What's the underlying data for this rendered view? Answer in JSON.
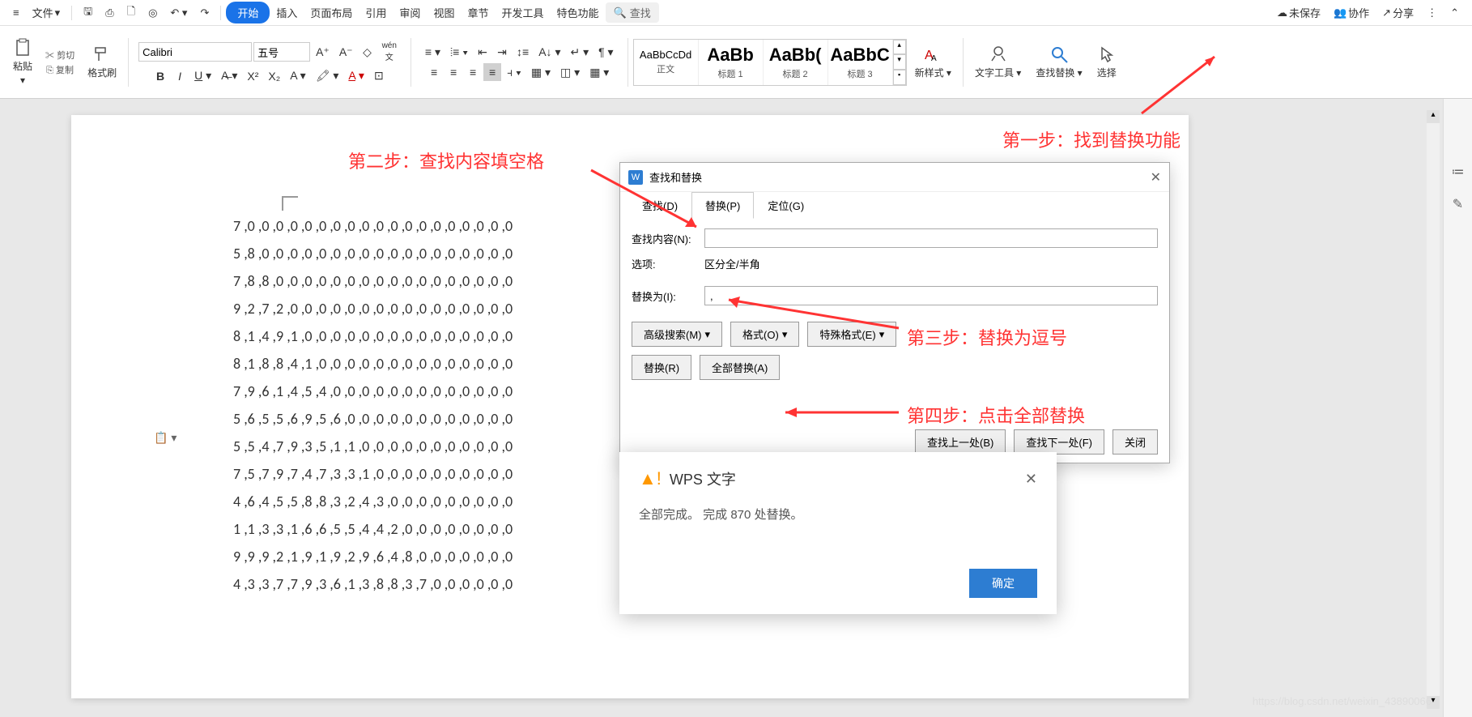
{
  "menubar": {
    "file": "文件",
    "tabs": [
      "开始",
      "插入",
      "页面布局",
      "引用",
      "审阅",
      "视图",
      "章节",
      "开发工具",
      "特色功能"
    ],
    "search": "查找",
    "unsaved": "未保存",
    "collab": "协作",
    "share": "分享"
  },
  "ribbon": {
    "paste": "粘贴",
    "cut": "剪切",
    "copy": "复制",
    "format_painter": "格式刷",
    "font_name": "Calibri",
    "font_size": "五号",
    "styles": [
      {
        "preview": "AaBbCcDd",
        "name": "正文",
        "big": false
      },
      {
        "preview": "AaBb",
        "name": "标题 1",
        "big": true
      },
      {
        "preview": "AaBb(",
        "name": "标题 2",
        "big": true
      },
      {
        "preview": "AaBbC",
        "name": "标题 3",
        "big": true
      }
    ],
    "new_style": "新样式",
    "text_tools": "文字工具",
    "find_replace": "查找替换",
    "select": "选择"
  },
  "annotations": {
    "step1": "第一步：找到替换功能",
    "step2": "第二步：查找内容填空格",
    "step3": "第三步：替换为逗号",
    "step4": "第四步：点击全部替换"
  },
  "doc_lines": [
    "7 ,0 ,0 ,0 ,0 ,0 ,0 ,0 ,0 ,0 ,0 ,0 ,0 ,0 ,0 ,0 ,0 ,0 ,0 ,0",
    "5 ,8 ,0 ,0 ,0 ,0 ,0 ,0 ,0 ,0 ,0 ,0 ,0 ,0 ,0 ,0 ,0 ,0 ,0 ,0",
    "7 ,8 ,8 ,0 ,0 ,0 ,0 ,0 ,0 ,0 ,0 ,0 ,0 ,0 ,0 ,0 ,0 ,0 ,0 ,0",
    "9 ,2 ,7 ,2 ,0 ,0 ,0 ,0 ,0 ,0 ,0 ,0 ,0 ,0 ,0 ,0 ,0 ,0 ,0 ,0",
    "8 ,1 ,4 ,9 ,1 ,0 ,0 ,0 ,0 ,0 ,0 ,0 ,0 ,0 ,0 ,0 ,0 ,0 ,0 ,0",
    "8 ,1 ,8 ,8 ,4 ,1 ,0 ,0 ,0 ,0 ,0 ,0 ,0 ,0 ,0 ,0 ,0 ,0 ,0 ,0",
    "7 ,9 ,6 ,1 ,4 ,5 ,4 ,0 ,0 ,0 ,0 ,0 ,0 ,0 ,0 ,0 ,0 ,0 ,0 ,0",
    "5 ,6 ,5 ,5 ,6 ,9 ,5 ,6 ,0 ,0 ,0 ,0 ,0 ,0 ,0 ,0 ,0 ,0 ,0 ,0",
    "5 ,5 ,4 ,7 ,9 ,3 ,5 ,1 ,1 ,0 ,0 ,0 ,0 ,0 ,0 ,0 ,0 ,0 ,0 ,0",
    "7 ,5 ,7 ,9 ,7 ,4 ,7 ,3 ,3 ,1 ,0 ,0 ,0 ,0 ,0 ,0 ,0 ,0 ,0 ,0",
    "4 ,6 ,4 ,5 ,5 ,8 ,8 ,3 ,2 ,4 ,3 ,0 ,0 ,0 ,0 ,0 ,0 ,0 ,0 ,0",
    "1 ,1 ,3 ,3 ,1 ,6 ,6 ,5 ,5 ,4 ,4 ,2 ,0 ,0 ,0 ,0 ,0 ,0 ,0 ,0",
    "9 ,9 ,9 ,2 ,1 ,9 ,1 ,9 ,2 ,9 ,6 ,4 ,8 ,0 ,0 ,0 ,0 ,0 ,0 ,0",
    "4 ,3 ,3 ,7 ,7 ,9 ,3 ,6 ,1 ,3 ,8 ,8 ,3 ,7 ,0 ,0 ,0 ,0 ,0 ,0"
  ],
  "dialog": {
    "title": "查找和替换",
    "tabs": {
      "find": "查找(D)",
      "replace": "替换(P)",
      "goto": "定位(G)"
    },
    "find_label": "查找内容(N):",
    "find_value": "",
    "options_label": "选项:",
    "options_value": "区分全/半角",
    "replace_label": "替换为(I):",
    "replace_value": ",",
    "adv_search": "高级搜索(M)",
    "format": "格式(O)",
    "special": "特殊格式(E)",
    "replace_btn": "替换(R)",
    "replace_all": "全部替换(A)",
    "find_prev": "查找上一处(B)",
    "find_next": "查找下一处(F)",
    "close": "关闭"
  },
  "msgbox": {
    "title": "WPS 文字",
    "message": "全部完成。 完成 870 处替换。",
    "ok": "确定"
  },
  "watermark": "https://blog.csdn.net/weixin_43890066"
}
